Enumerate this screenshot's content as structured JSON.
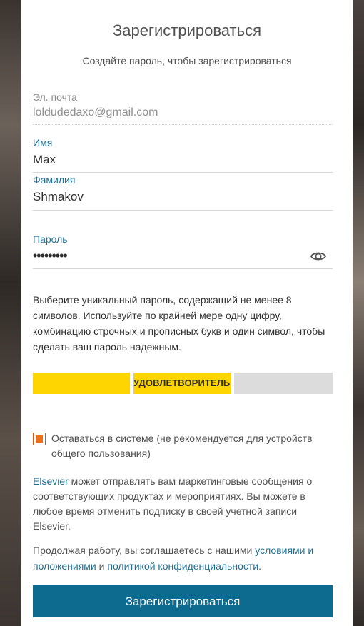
{
  "form": {
    "title": "Зарегистрироваться",
    "subtitle": "Создайте пароль, чтобы зарегистрироваться"
  },
  "email": {
    "label": "Эл. почта",
    "value": "loldudedaxo@gmail.com"
  },
  "first_name": {
    "label": "Имя",
    "value": "Max"
  },
  "last_name": {
    "label": "Фамилия",
    "value": "Shmakov"
  },
  "password": {
    "label": "Пароль",
    "value": "•••••••••",
    "toggle_icon": "eye-icon"
  },
  "password_hint": "Выберите уникальный пароль, содержащий не менее 8 символов. Используйте по крайней мере одну цифру, комбинацию строчных и прописных букв и один символ, чтобы сделать ваш пароль надежным.",
  "strength": {
    "label": "УДОВЛЕТВОРИТЕЛЬНО",
    "filled_segments": 2,
    "total_segments": 3,
    "fill_color": "#fed500",
    "empty_color": "#dcdcdc"
  },
  "remember": {
    "checked": true,
    "label": "Оставаться в системе (не рекомендуется для устройств общего пользования)"
  },
  "marketing": {
    "brand_link": "Elsevier",
    "text": " может отправлять вам маркетинговые сообщения о соответствующих продуктах и мероприятиях. Вы можете в любое время отменить подписку в своей учетной записи ",
    "brand_end": "Elsevier",
    "end": "."
  },
  "terms": {
    "prefix": "Продолжая работу, вы соглашаетесь с нашими ",
    "terms_link": "условиями и положениями",
    "middle": " и ",
    "privacy_link": "политикой конфиденциальности",
    "suffix": "."
  },
  "register_button": "Зарегистрироваться",
  "colors": {
    "accent": "#0c6b8e",
    "label": "#1d6e8f",
    "checkbox": "#e9711c",
    "meter": "#fed500"
  }
}
